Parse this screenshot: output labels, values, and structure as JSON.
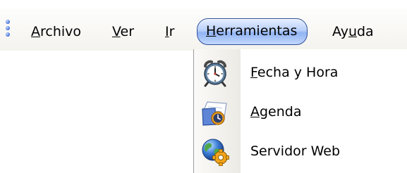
{
  "menubar": {
    "grip_icon": "grip-dots-icon",
    "items": [
      {
        "label": "Archivo",
        "accel": "A",
        "rest": "rchivo"
      },
      {
        "label": "Ver",
        "accel": "V",
        "rest": "er"
      },
      {
        "label": "Ir",
        "accel": "I",
        "rest": "r"
      },
      {
        "label": "Herramientas",
        "accel": "H",
        "rest": "erramientas",
        "active": true
      },
      {
        "label": "Ayuda",
        "pre": "Ay",
        "accel": "u",
        "rest": "da"
      }
    ]
  },
  "dropdown": {
    "items": [
      {
        "label": "Fecha y Hora",
        "accel": "F",
        "rest": "echa y Hora",
        "icon": "alarm-clock-icon"
      },
      {
        "label": "Agenda",
        "accel": "A",
        "rest": "genda",
        "icon": "agenda-clock-icon"
      },
      {
        "label": "Servidor Web",
        "text": "Servidor Web",
        "icon": "globe-gear-icon"
      }
    ]
  },
  "colors": {
    "active_menu_fill": "#b9d0fb",
    "active_menu_border": "#2d4f9a",
    "menubar_bg": "#f4f3ee"
  }
}
